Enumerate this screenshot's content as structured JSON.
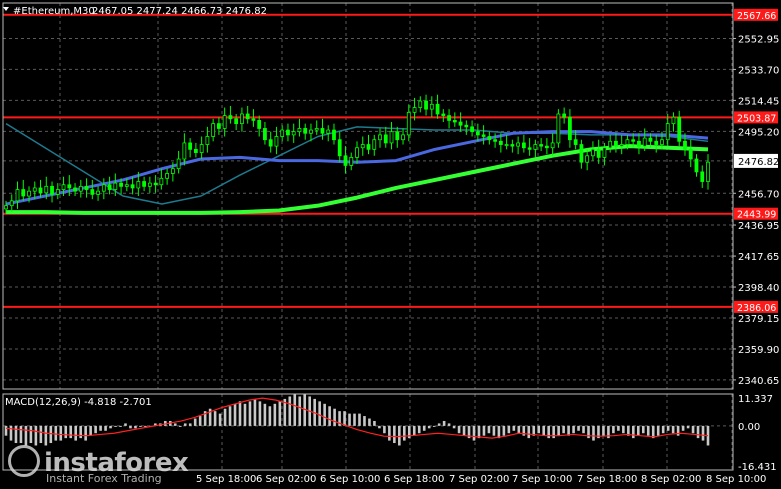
{
  "header": {
    "symbol": "#Ethereum,M30",
    "ohlc": "2467.05 2477.24 2466.73 2476.82",
    "macd_label": "MACD(12,26,9) -4.818 -2.701"
  },
  "price_axis": {
    "ticks": [
      "2552.95",
      "2533.70",
      "2514.45",
      "2495.20",
      "2476.82",
      "2456.70",
      "2436.95",
      "2417.65",
      "2398.40",
      "2379.15",
      "2359.90",
      "2340.65"
    ],
    "level_tags": [
      "2567.66",
      "2503.87",
      "2443.99",
      "2386.06"
    ]
  },
  "macd_axis": {
    "ticks": [
      "11.337",
      "0.00",
      "-16.431"
    ]
  },
  "time_axis": {
    "ticks": [
      "5 Sep 18:00",
      "6 Sep 02:00",
      "6 Sep 10:00",
      "6 Sep 18:00",
      "7 Sep 02:00",
      "7 Sep 10:00",
      "7 Sep 18:00",
      "8 Sep 02:00",
      "8 Sep 10:00"
    ]
  },
  "logo": {
    "name": "instaforex",
    "tagline": "Instant Forex Trading"
  },
  "colors": {
    "background": "#000000",
    "grid": "#5a5a5a",
    "level": "#ff1a1a",
    "candles": "#00ff00",
    "ma_green": "#33ff33",
    "ma_blue": "#4a68e0",
    "ma_teal": "#1e7a8e",
    "macd_hist": "#c8c8c8",
    "macd_signal": "#ff2020"
  },
  "chart_data": {
    "type": "candlestick",
    "title": "#Ethereum,M30",
    "current_price": 2476.82,
    "ylim": [
      2335,
      2575
    ],
    "levels": [
      2567.66,
      2503.87,
      2443.99,
      2386.06
    ],
    "x_labels": [
      "5 Sep 18:00",
      "6 Sep 02:00",
      "6 Sep 10:00",
      "6 Sep 18:00",
      "7 Sep 02:00",
      "7 Sep 10:00",
      "7 Sep 18:00",
      "8 Sep 02:00",
      "8 Sep 10:00"
    ],
    "close_series": [
      2449,
      2452,
      2459,
      2455,
      2458,
      2460,
      2457,
      2461,
      2456,
      2459,
      2462,
      2460,
      2458,
      2461,
      2459,
      2456,
      2458,
      2462,
      2459,
      2463,
      2461,
      2462,
      2460,
      2464,
      2461,
      2463,
      2462,
      2466,
      2469,
      2472,
      2478,
      2488,
      2484,
      2482,
      2487,
      2492,
      2500,
      2497,
      2505,
      2503,
      2500,
      2506,
      2503,
      2502,
      2497,
      2490,
      2486,
      2492,
      2496,
      2493,
      2495,
      2497,
      2494,
      2496,
      2497,
      2494,
      2496,
      2490,
      2480,
      2474,
      2479,
      2485,
      2487,
      2484,
      2490,
      2493,
      2488,
      2495,
      2490,
      2493,
      2507,
      2510,
      2514,
      2509,
      2512,
      2506,
      2505,
      2502,
      2501,
      2499,
      2498,
      2495,
      2493,
      2492,
      2490,
      2489,
      2487,
      2487,
      2486,
      2488,
      2485,
      2484,
      2487,
      2486,
      2485,
      2488,
      2506,
      2504,
      2490,
      2487,
      2476,
      2480,
      2484,
      2479,
      2485,
      2489,
      2486,
      2487,
      2490,
      2489,
      2486,
      2491,
      2489,
      2487,
      2490,
      2500,
      2504,
      2489,
      2484,
      2478,
      2470,
      2464,
      2476
    ],
    "ma_green": [
      2445,
      2445,
      2444.5,
      2444.5,
      2444.5,
      2444.5,
      2445,
      2446,
      2449,
      2454,
      2460,
      2465,
      2470,
      2475,
      2480,
      2484,
      2486,
      2485,
      2484
    ],
    "ma_blue": [
      2450,
      2455,
      2460,
      2465,
      2472,
      2478,
      2479,
      2477,
      2477,
      2476,
      2477,
      2484,
      2489,
      2494,
      2495,
      2495,
      2493,
      2493,
      2491
    ],
    "ma_teal": [
      2500,
      2485,
      2470,
      2455,
      2450,
      2455,
      2468,
      2480,
      2492,
      2498,
      2497,
      2496,
      2496,
      2494,
      2494,
      2493,
      2493,
      2492,
      2489
    ],
    "macd": {
      "ylim": [
        -18,
        13
      ],
      "signal": [
        -1,
        -1.5,
        -2,
        -3,
        -3.5,
        -3.8,
        -4,
        -3.5,
        -3,
        -2,
        -1,
        0,
        1,
        2,
        3.5,
        5.5,
        7.5,
        9,
        10.5,
        11.3,
        10.5,
        9,
        7,
        5,
        2.5,
        0.5,
        -1.5,
        -3,
        -4.2,
        -4.4,
        -4,
        -3.5,
        -3,
        -3.5,
        -4,
        -4.5,
        -5,
        -4.2,
        -3,
        -3.5,
        -4,
        -4,
        -3.5,
        -4,
        -4.2,
        -4,
        -3.5,
        -4,
        -4.5,
        -3.5,
        -3,
        -3.5,
        -4
      ],
      "histogram": [
        -4,
        -6,
        -7,
        -7,
        -8,
        -7,
        -8,
        -7,
        -8,
        -7,
        -6,
        -6,
        -5,
        -5,
        -6,
        -5,
        -6,
        -4,
        -3,
        -2,
        -2,
        -1,
        0,
        0,
        1,
        -1,
        -1,
        0,
        0,
        0,
        1,
        1,
        2,
        2,
        1,
        0,
        1,
        1,
        3,
        4,
        6,
        7,
        6,
        5,
        7,
        8,
        9,
        10,
        9,
        10,
        11,
        10,
        9,
        8,
        9,
        10,
        11,
        12,
        13,
        12,
        13,
        12,
        11,
        10,
        9,
        8,
        7,
        6,
        6,
        5,
        5,
        5,
        4,
        3,
        2,
        -1,
        -3,
        -6,
        -7,
        -8,
        -6,
        -5,
        -4,
        -3,
        -2,
        -1,
        0,
        1,
        2,
        1,
        -1,
        -3,
        -4,
        -5,
        -6,
        -5,
        -4,
        -3,
        -4,
        -5,
        -4,
        -3,
        -2,
        -3,
        -4,
        -5,
        -4,
        -3,
        -4,
        -5,
        -5,
        -4,
        -3,
        -4,
        -3,
        -2,
        -3,
        -5,
        -6,
        -5,
        -4,
        -5,
        -3,
        -2,
        -3,
        -4,
        -5,
        -4,
        -3,
        -4,
        -5,
        -4,
        -3,
        -2,
        -3,
        -4,
        -2,
        -1,
        -3,
        -5,
        -6,
        -8
      ]
    }
  }
}
